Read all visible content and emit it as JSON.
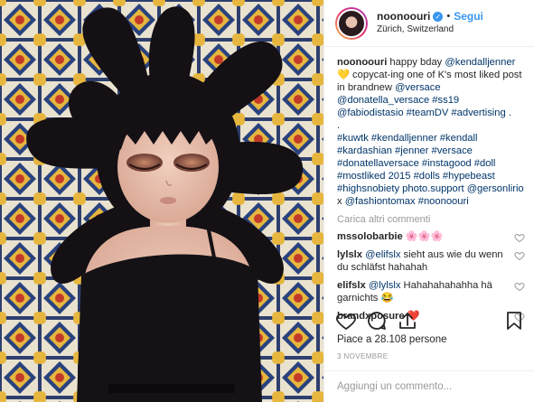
{
  "header": {
    "username": "noonoouri",
    "verified_mark": "✓",
    "separator": "•",
    "follow_label": "Segui",
    "location": "Zürich, Switzerland"
  },
  "caption": {
    "username": "noonoouri",
    "text_1": " happy bday ",
    "mention_1": "@kendalljenner",
    "emoji_heart": "💛",
    "text_2": " copycat-ing one of K's most liked post in brandnew ",
    "mention_2": "@versace",
    "mention_3": "@donatella_versace",
    "tag_1": " #ss19 ",
    "mention_4": "@fabiodistasio",
    "tag_2": "#teamDV #advertising",
    "text_3": " .",
    "dot_line": ".",
    "hashtags": "#kuwtk #kendalljenner #kendall #kardashian #jenner #versace #donatellaversace #instagood #doll #mostliked 2015 #dolls #hypebeast #highsnobiety photo.support ",
    "mention_5": "@gersonlirio",
    "text_4": " x ",
    "mention_6": "@fashiontomax",
    "tag_3": " #noonoouri"
  },
  "load_more_label": "Carica altri commenti",
  "comments": [
    {
      "user": "mssolobarbie",
      "text": "🌸🌸🌸",
      "mention": ""
    },
    {
      "user": "lylslx",
      "mention": "@elifslx",
      "text": " sieht aus wie du wenn du schläfst hahahah"
    },
    {
      "user": "elifslx",
      "mention": "@lylslx",
      "text": " Hahahahahahha hä garnichts 😂"
    },
    {
      "user": "brandxposure",
      "text": "❤️",
      "mention": ""
    }
  ],
  "actions": {
    "icons": [
      "heart-icon",
      "comment-icon",
      "share-icon",
      "bookmark-icon"
    ]
  },
  "likes_text": "Piace a 28.108 persone",
  "date_text": "3 NOVEMBRE",
  "add_comment_placeholder": "Aggiungi un commento...",
  "colors": {
    "link": "#003569",
    "follow": "#3897f0",
    "muted": "#999999"
  }
}
